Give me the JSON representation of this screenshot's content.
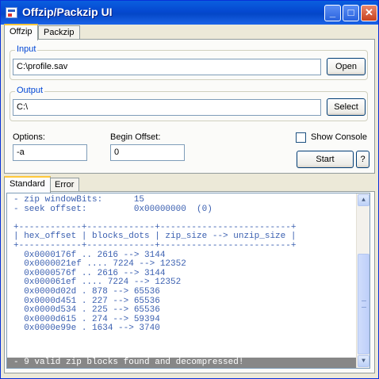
{
  "window": {
    "title": "Offzip/Packzip UI"
  },
  "main_tabs": [
    {
      "label": "Offzip"
    },
    {
      "label": "Packzip"
    }
  ],
  "input": {
    "group_label": "Input",
    "value": "C:\\profile.sav",
    "button": "Open"
  },
  "output": {
    "group_label": "Output",
    "value": "C:\\",
    "button": "Select"
  },
  "options": {
    "label": "Options:",
    "value": "-a"
  },
  "begin_offset": {
    "label": "Begin Offset:",
    "value": "0"
  },
  "show_console": {
    "label": "Show Console",
    "checked": false
  },
  "start_button": "Start",
  "help_button": "?",
  "output_tabs": [
    {
      "label": "Standard"
    },
    {
      "label": "Error"
    }
  ],
  "console": {
    "lines": [
      "- zip windowBits:      15",
      "- seek offset:         0x00000000  (0)",
      "",
      "+------------+-------------+-------------------------+",
      "| hex_offset | blocks_dots | zip_size --> unzip_size |",
      "+------------+-------------+-------------------------+",
      "  0x0000176f .. 2616 --> 3144",
      "  0x0000021ef .... 7224 --> 12352",
      "  0x0000576f .. 2616 --> 3144",
      "  0x000061ef .... 7224 --> 12352",
      "  0x0000d02d . 878 --> 65536",
      "  0x0000d451 . 227 --> 65536",
      "  0x0000d534 . 225 --> 65536",
      "  0x0000d615 . 274 --> 59394",
      "  0x0000e99e . 1634 --> 3740"
    ],
    "status": "- 9 valid zip blocks found and decompressed!"
  }
}
